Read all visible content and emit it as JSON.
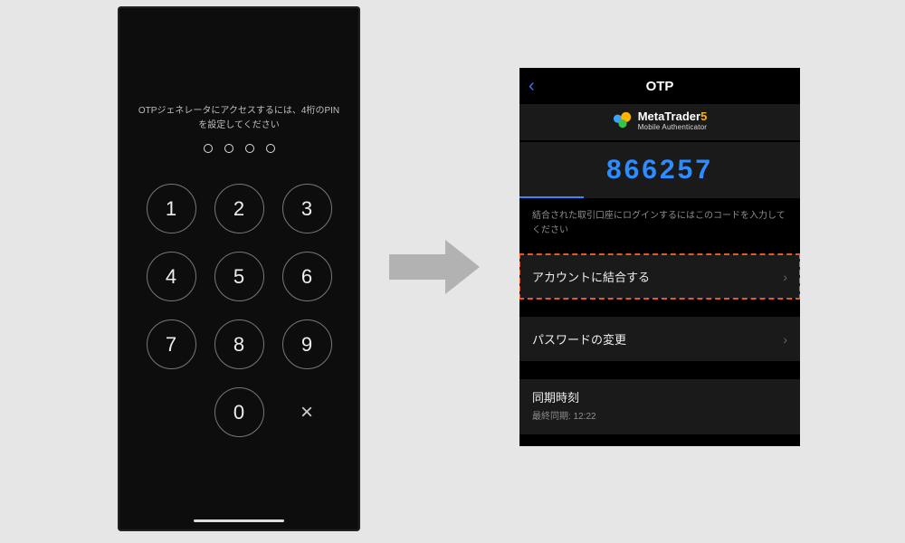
{
  "left_phone": {
    "prompt": "OTPジェネレータにアクセスするには、4桁のPINを設定してください",
    "keys": [
      "1",
      "2",
      "3",
      "4",
      "5",
      "6",
      "7",
      "8",
      "9",
      "0"
    ],
    "delete_glyph": "×"
  },
  "right_phone": {
    "nav": {
      "back_glyph": "‹",
      "title": "OTP"
    },
    "brand": {
      "name_main": "MetaTrader",
      "name_suffix": "5",
      "subtitle": "Mobile Authenticator"
    },
    "otp_code": "866257",
    "hint": "結合された取引口座にログインするにはこのコードを入力してください",
    "rows": {
      "bind_account": "アカウントに結合する",
      "change_password": "パスワードの変更",
      "chevron": "›"
    },
    "sync": {
      "title": "同期時刻",
      "last": "最終同期: 12:22"
    }
  }
}
